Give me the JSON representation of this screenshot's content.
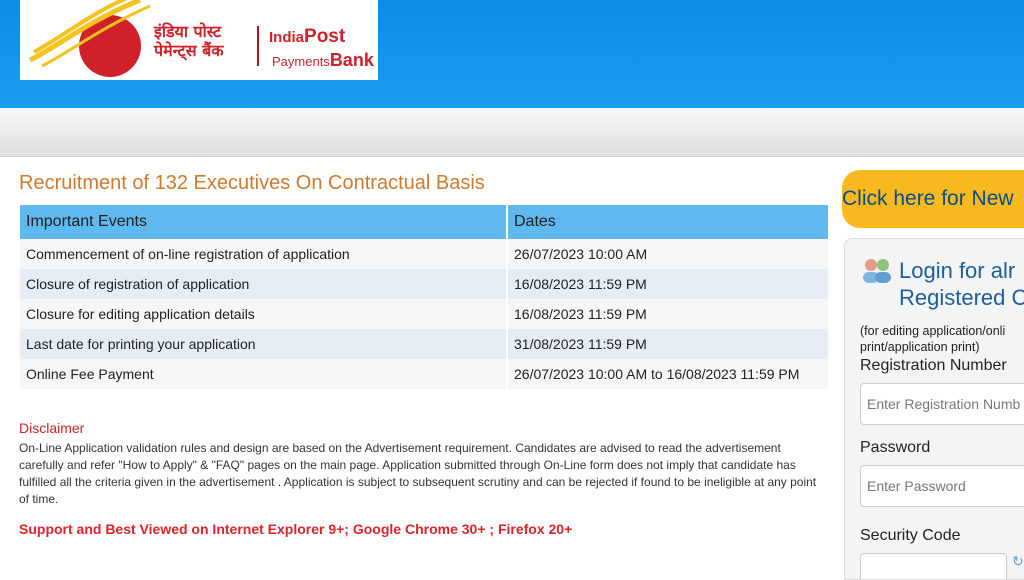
{
  "brand": {
    "hindi_line1": "इंडिया पोस्ट",
    "hindi_line2": "पेमेन्ट्स बैंक",
    "en_line1_small": "India",
    "en_line1_big": "Post",
    "en_line2_small": "Payments",
    "en_line2_big": "Bank",
    "colors": {
      "red": "#d0202a",
      "yellow": "#f7c21e",
      "header_blue": "#0b8fe6"
    }
  },
  "page": {
    "title": "Recruitment of 132 Executives On Contractual Basis"
  },
  "events_table": {
    "headers": [
      "Important Events",
      "Dates"
    ],
    "rows": [
      {
        "event": "Commencement of on-line registration of application",
        "date": "26/07/2023 10:00 AM"
      },
      {
        "event": "Closure of registration of application",
        "date": "16/08/2023 11:59 PM"
      },
      {
        "event": "Closure for editing application details",
        "date": "16/08/2023 11:59 PM"
      },
      {
        "event": "Last date for printing your application",
        "date": "31/08/2023 11:59 PM"
      },
      {
        "event": "Online Fee Payment",
        "date": "26/07/2023 10:00 AM to 16/08/2023 11:59 PM"
      }
    ]
  },
  "disclaimer": {
    "title": "Disclaimer",
    "text": "On-Line Application validation rules and design are based on the Advertisement requirement. Candidates are advised to read the advertisement carefully and refer \"How to Apply\" & \"FAQ\" pages on the main page. Application submitted through On-Line form does not imply that candidate has fulfilled all the criteria given in the advertisement . Application is subject to subsequent scrutiny and can be rejected if found to be ineligible at any point of time."
  },
  "support_text": "Support and Best Viewed on Internet Explorer 9+; Google Chrome 30+ ; Firefox 20+",
  "sidebar": {
    "new_button_label": "Click here for New",
    "login_title_line1": "Login for alr",
    "login_title_line2": "Registered C",
    "login_sub_line1": "(for editing application/onli",
    "login_sub_line2": "print/application print)",
    "reg_label": "Registration Number",
    "reg_placeholder": "Enter Registration Numb",
    "password_label": "Password",
    "password_placeholder": "Enter Password",
    "security_label": "Security Code",
    "icons": [
      "users-icon",
      "refresh-icon"
    ]
  }
}
